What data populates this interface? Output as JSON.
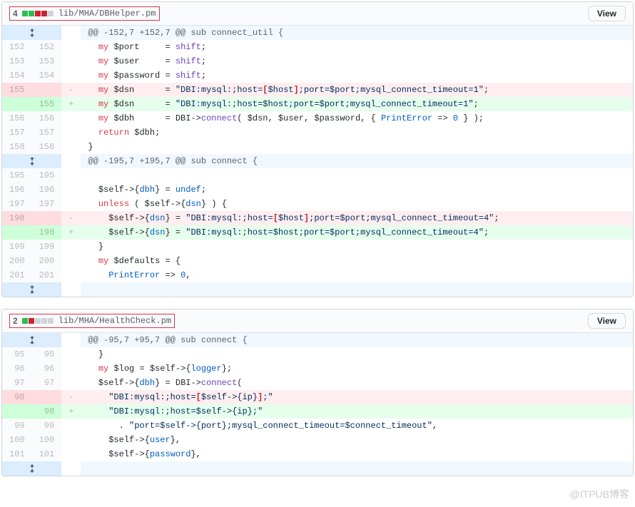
{
  "files": [
    {
      "changeCount": "4",
      "blocks": [
        "add",
        "add",
        "del",
        "del",
        "neutral"
      ],
      "path": "lib/MHA/DBHelper.pm",
      "viewLabel": "View"
    },
    {
      "changeCount": "2",
      "blocks": [
        "add",
        "del",
        "neutral",
        "neutral",
        "neutral"
      ],
      "path": "lib/MHA/HealthCheck.pm",
      "viewLabel": "View"
    }
  ],
  "hunks": {
    "h1": "@@ -152,7 +152,7 @@ sub connect_util {",
    "h2": "@@ -195,7 +195,7 @@ sub connect {",
    "h3": "@@ -95,7 +95,7 @@ sub connect {"
  },
  "lines": {
    "f0": {
      "l152a": "152",
      "l152b": "152",
      "l153a": "153",
      "l153b": "153",
      "l154a": "154",
      "l154b": "154",
      "l155a": "155",
      "l155b": "155",
      "l156a": "156",
      "l156b": "156",
      "l157a": "157",
      "l157b": "157",
      "l158a": "158",
      "l158b": "158",
      "l195a": "195",
      "l195b": "195",
      "l196a": "196",
      "l196b": "196",
      "l197a": "197",
      "l197b": "197",
      "l198a": "198",
      "l198b": "198",
      "l199a": "199",
      "l199b": "199",
      "l200a": "200",
      "l200b": "200",
      "l201a": "201",
      "l201b": "201"
    },
    "f1": {
      "l95a": "95",
      "l95b": "95",
      "l96a": "96",
      "l96b": "96",
      "l97a": "97",
      "l97b": "97",
      "l98a": "98",
      "l98b": "98",
      "l99a": "99",
      "l99b": "99",
      "l100a": "100",
      "l100b": "100",
      "l101a": "101",
      "l101b": "101"
    }
  },
  "code": {
    "f0": {
      "port": "  my $port     = shift;",
      "user": "  my $user     = shift;",
      "password": "  my $password = shift;",
      "dsn_del": "  my $dsn      = \"DBI:mysql:;host=[$host];port=$port;mysql_connect_timeout=1\";",
      "dsn_add": "  my $dsn      = \"DBI:mysql:;host=$host;port=$port;mysql_connect_timeout=1\";",
      "dbh": "  my $dbh      = DBI->connect( $dsn, $user, $password, { PrintError => 0 } );",
      "return": "  return $dbh;",
      "brace": "}",
      "selfdbh": "  $self->{dbh} = undef;",
      "unless": "  unless ( $self->{dsn} ) {",
      "dsn2_del": "    $self->{dsn} = \"DBI:mysql:;host=[$host];port=$port;mysql_connect_timeout=4\";",
      "dsn2_add": "    $self->{dsn} = \"DBI:mysql:;host=$host;port=$port;mysql_connect_timeout=4\";",
      "brace2": "  }",
      "defaults": "  my $defaults = {",
      "printerr": "    PrintError => 0,"
    },
    "f1": {
      "brace": "  }",
      "log": "  my $log = $self->{logger};",
      "dbhconn": "  $self->{dbh} = DBI->connect(",
      "ip_del": "    \"DBI:mysql:;host=[$self->{ip}];\"",
      "ip_add": "    \"DBI:mysql:;host=$self->{ip};\"",
      "portline": "      . \"port=$self->{port};mysql_connect_timeout=$connect_timeout\",",
      "user": "    $self->{user},",
      "password": "    $self->{password},"
    }
  },
  "watermark": "@ITPUB博客",
  "chart_data": {
    "type": "table",
    "files": [
      {
        "path": "lib/MHA/DBHelper.pm",
        "additions": 2,
        "deletions": 2,
        "total": 4
      },
      {
        "path": "lib/MHA/HealthCheck.pm",
        "additions": 1,
        "deletions": 1,
        "total": 2
      }
    ]
  }
}
